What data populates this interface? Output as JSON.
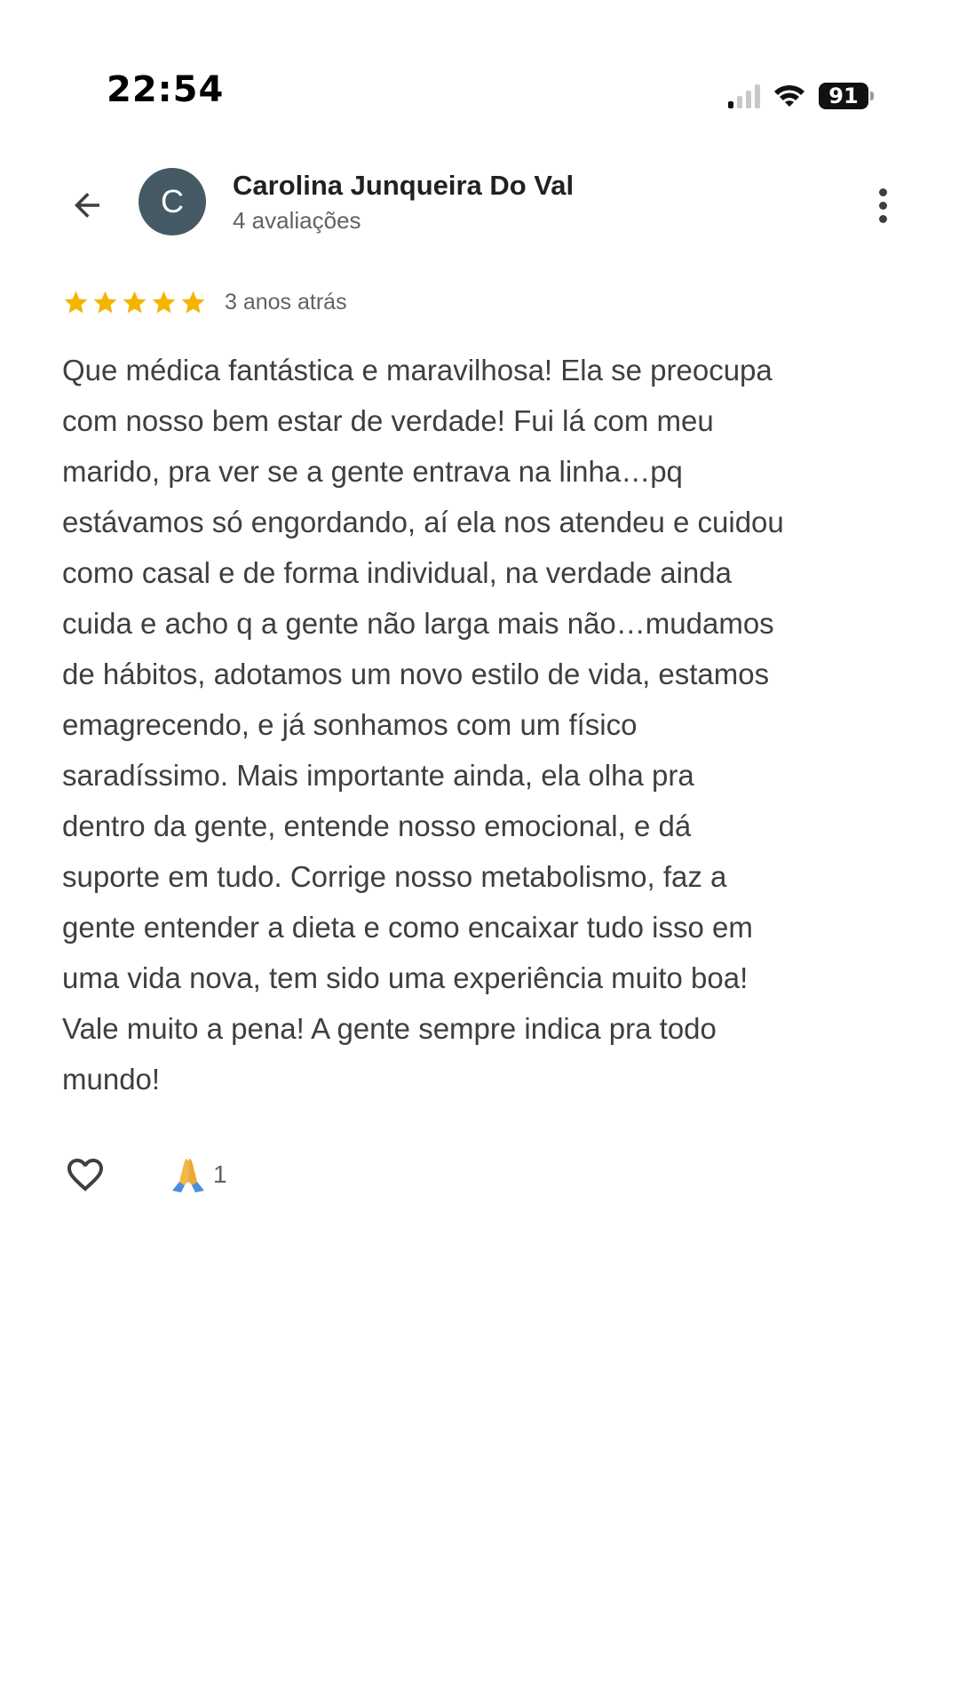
{
  "status_bar": {
    "time": "22:54",
    "battery": "91",
    "icons": [
      "signal-icon",
      "wifi-icon",
      "battery-icon"
    ]
  },
  "header": {
    "back_icon": "arrow-back-icon",
    "avatar_letter": "C",
    "avatar_color": "#455a64",
    "reviewer_name": "Carolina Junqueira Do Val",
    "reviewer_reviews": "4 avaliações",
    "more_icon": "more-vert-icon"
  },
  "review": {
    "rating": 5,
    "rating_max": 5,
    "star_color": "#f4b400",
    "time_ago": "3 anos atrás",
    "lines": [
      "Que médica fantástica e maravilhosa! Ela se preocupa",
      "com nosso bem estar de verdade! Fui lá com meu",
      "marido, pra ver se a gente entrava na linha…pq",
      "estávamos só engordando, aí ela nos atendeu e cuidou",
      "como casal e de forma individual, na verdade ainda",
      "cuida e acho q a gente não larga mais não…mudamos",
      "de hábitos, adotamos um novo estilo de vida, estamos",
      "emagrecendo, e já sonhamos com um físico",
      "saradíssimo. Mais importante ainda, ela olha pra",
      "dentro da gente, entende nosso emocional, e dá",
      "suporte em tudo. Corrige nosso metabolismo, faz a",
      "gente entender a dieta e como encaixar tudo isso em",
      "uma vida nova, tem sido uma experiência muito boa!",
      "Vale muito a pena! A gente sempre indica pra todo",
      "mundo!"
    ]
  },
  "reactions": {
    "like_icon": "heart-outline-icon",
    "emoji_icon": "folded-hands-emoji-icon",
    "count": "1"
  }
}
